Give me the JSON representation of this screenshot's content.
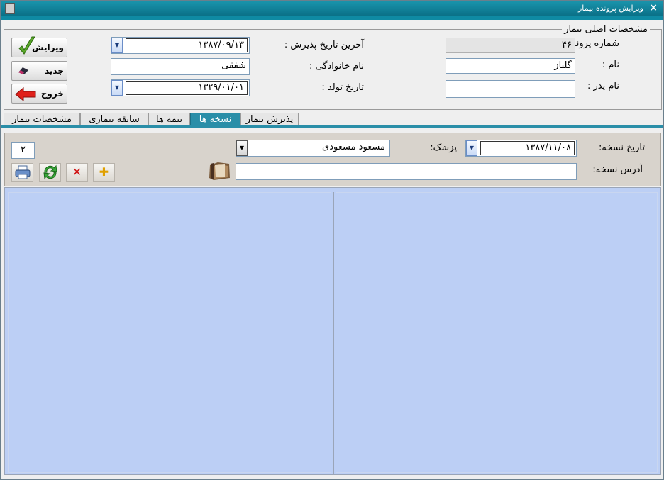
{
  "window": {
    "title": "ویرایش پرونده بیمار",
    "close_glyph": "×"
  },
  "patient_group": {
    "title": "مشخصات اصلی بیمار",
    "file_number_label": "شماره پرونده :",
    "file_number_value": "۴۶",
    "first_name_label": "نام :",
    "first_name_value": "گلناز",
    "father_name_label": "نام پدر :",
    "father_name_value": "",
    "last_admission_label": "آخرین تاریخ پذیرش :",
    "last_admission_value": "۱۳۸۷/۰۹/۱۳",
    "last_name_label": "نام خانوادگی :",
    "last_name_value": "شفقی",
    "birth_date_label": "تاریخ تولد :",
    "birth_date_value": "۱۳۲۹/۰۱/۰۱"
  },
  "side_buttons": {
    "edit": "ویرایش",
    "new": "جدید",
    "exit": "خروج"
  },
  "tabs": [
    {
      "label": "پذیرش بیمار"
    },
    {
      "label": "نسخه ها"
    },
    {
      "label": "بیمه ها"
    },
    {
      "label": "سابقه بیماری"
    },
    {
      "label": "مشخصات بیمار"
    }
  ],
  "prescription": {
    "date_label": "تاریخ نسخه:",
    "date_value": "۱۳۸۷/۱۱/۰۸",
    "doctor_label": "پزشک:",
    "doctor_value": "مسعود مسعودی",
    "address_label": "آدرس نسخه:",
    "address_value": "",
    "count_value": "۲"
  },
  "toolbar": {
    "print_icon": "printer-icon",
    "refresh_icon": "refresh-icon",
    "delete_glyph": "✕",
    "add_glyph": "✚"
  },
  "colors": {
    "accent": "#2a8ea8",
    "content_bg": "#bccff5",
    "titlebar": "#0f8aa3"
  }
}
